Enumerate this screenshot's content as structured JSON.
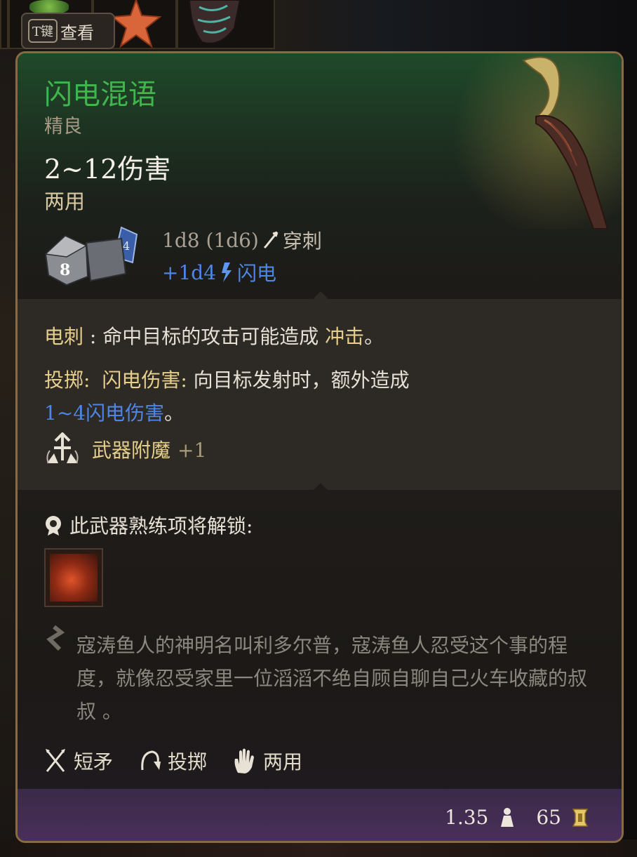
{
  "background": {
    "look_key": "T键",
    "look_label": "查看"
  },
  "item": {
    "name": "闪电混语",
    "rarity": "精良",
    "damage_total": "2~12伤害",
    "handedness": "两用",
    "dice_face": "8",
    "damage_line_1": "1d8 (1d6)",
    "damage_type_1": "穿刺",
    "damage_line_2": "+1d4",
    "damage_type_2": "闪电"
  },
  "properties": {
    "shock_name": "电刺",
    "shock_text": " : 命中目标的攻击可能造成 ",
    "shock_effect": "冲击",
    "shock_end": "。",
    "throw_name": "投掷:",
    "throw_sub": "闪电伤害:",
    "throw_text": " 向目标发射时，额外造成",
    "throw_damage": "1~4闪电伤害",
    "throw_end": "。",
    "enchant_label": "武器附魔",
    "enchant_value": "+1"
  },
  "unlock": {
    "title": "此武器熟练项将解锁:",
    "lore": "寇涛鱼人的神明名叫利多尔普，寇涛鱼人忍受这个事的程度，就像忍受家里一位滔滔不绝自顾自聊自己火车收藏的叔叔 。"
  },
  "tags": [
    {
      "label": "短矛",
      "icon": "crossed-spears-icon"
    },
    {
      "label": "投掷",
      "icon": "throw-arc-icon"
    },
    {
      "label": "两用",
      "icon": "hand-icon"
    }
  ],
  "footer": {
    "weight": "1.35",
    "weight_icon": "weight-icon",
    "value": "65",
    "value_icon": "gold-icon"
  },
  "colors": {
    "name": "#3fb54d",
    "border": "#8a6a45",
    "gold_text": "#e6cf8c",
    "lightning_blue": "#4d86e6",
    "footer_purple": "#4b2f5c"
  }
}
